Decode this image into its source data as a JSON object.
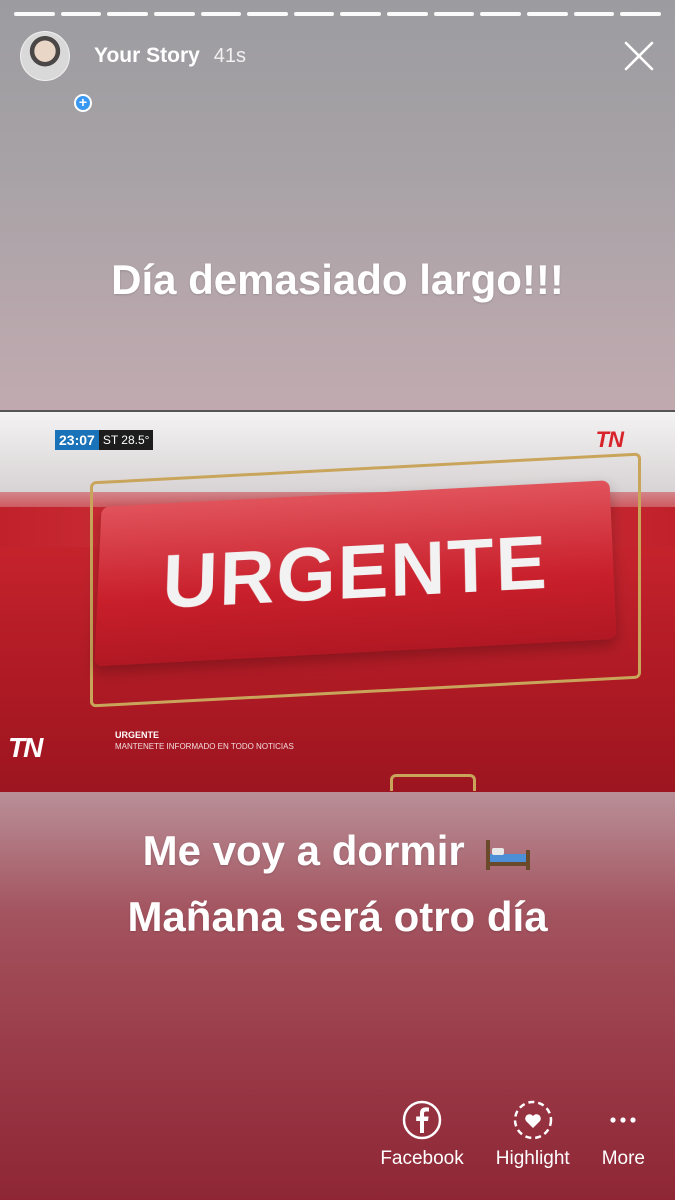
{
  "progress_segments": 14,
  "header": {
    "owner": "Your Story",
    "time": "41s"
  },
  "caption_top": "Día demasiado largo!!!",
  "caption_bottom": {
    "line1": "Me voy a dormir",
    "line2": "Mañana será otro día"
  },
  "tv": {
    "clock": "23:07",
    "temp": "ST 28.5°",
    "logo": "TN",
    "headline": "URGENTE",
    "ticker_title": "URGENTE",
    "ticker_subtitle": "MANTENETE INFORMADO EN TODO NOTICIAS"
  },
  "actions": [
    {
      "label": "Facebook",
      "icon": "facebook-icon"
    },
    {
      "label": "Highlight",
      "icon": "highlight-icon"
    },
    {
      "label": "More",
      "icon": "more-icon"
    }
  ]
}
